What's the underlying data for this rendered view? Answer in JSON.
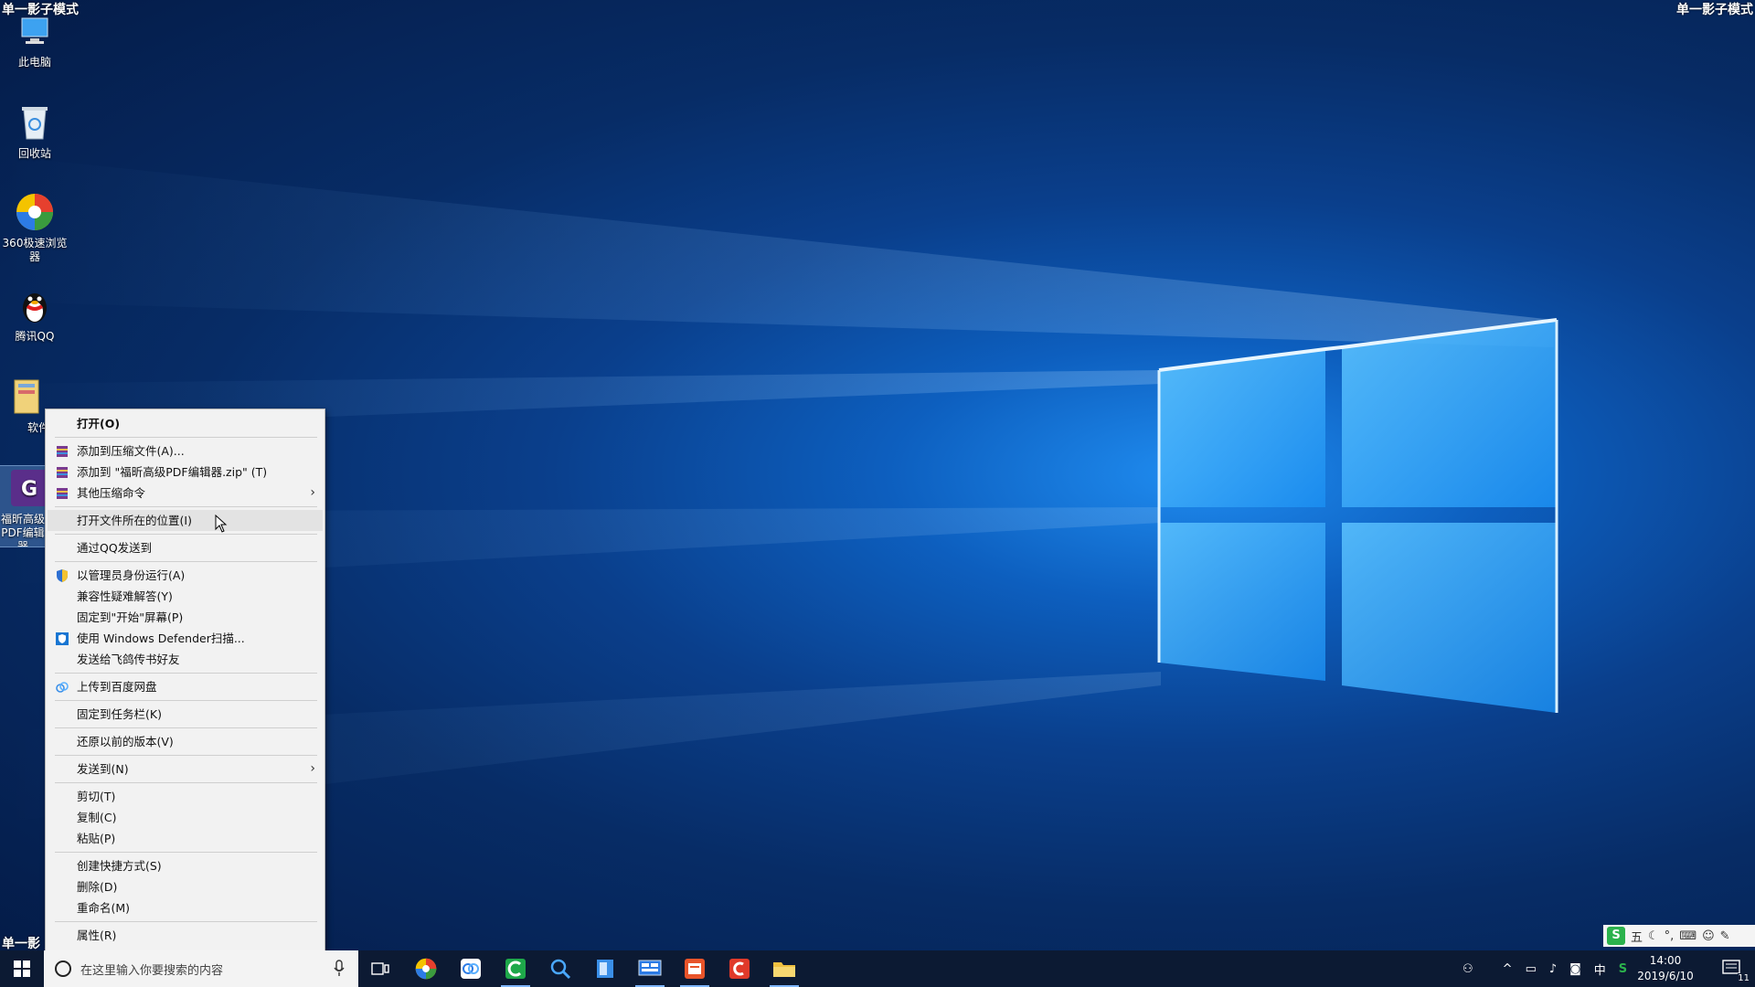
{
  "watermark": {
    "text": "单一影子模式",
    "truncated": "单一影"
  },
  "desktop_icons": [
    {
      "label": "此电脑",
      "icon": "computer-icon"
    },
    {
      "label": "回收站",
      "icon": "recycle-bin-icon"
    },
    {
      "label": "360极速浏览器",
      "icon": "browser-360-icon"
    },
    {
      "label": "腾讯QQ",
      "icon": "qq-icon"
    },
    {
      "label": "软件",
      "icon": "folder-icon"
    },
    {
      "label": "福昕高级PDF编辑器",
      "icon": "foxit-pdf-icon"
    }
  ],
  "context_menu": {
    "items": [
      {
        "label": "打开(O)",
        "bold": true
      },
      {
        "label": "添加到压缩文件(A)...",
        "icon": "winrar-icon"
      },
      {
        "label": "添加到 \"福昕高级PDF编辑器.zip\" (T)",
        "icon": "winrar-icon"
      },
      {
        "label": "其他压缩命令",
        "icon": "winrar-icon",
        "submenu": true
      },
      {
        "label": "打开文件所在的位置(I)",
        "hover": true
      },
      {
        "label": "通过QQ发送到"
      },
      {
        "label": "以管理员身份运行(A)",
        "icon": "uac-shield-icon"
      },
      {
        "label": "兼容性疑难解答(Y)"
      },
      {
        "label": "固定到\"开始\"屏幕(P)"
      },
      {
        "label": "使用 Windows Defender扫描...",
        "icon": "defender-icon"
      },
      {
        "label": "发送给飞鸽传书好友"
      },
      {
        "label": "上传到百度网盘",
        "icon": "baidu-netdisk-icon"
      },
      {
        "label": "固定到任务栏(K)"
      },
      {
        "label": "还原以前的版本(V)"
      },
      {
        "label": "发送到(N)",
        "submenu": true
      },
      {
        "label": "剪切(T)"
      },
      {
        "label": "复制(C)"
      },
      {
        "label": "粘贴(P)"
      },
      {
        "label": "创建快捷方式(S)"
      },
      {
        "label": "删除(D)"
      },
      {
        "label": "重命名(M)"
      },
      {
        "label": "属性(R)"
      }
    ],
    "submenu_arrow": "›"
  },
  "taskbar": {
    "search_placeholder": "在这里输入你要搜索的内容",
    "apps": [
      "task-view-icon",
      "browser-360-icon",
      "photos-icon",
      "camtasia-icon",
      "search-app-icon",
      "notepad-icon",
      "control-panel-icon",
      "foxit-reader-icon",
      "snagit-icon",
      "file-explorer-icon"
    ],
    "tray_ime": "中",
    "clock_time": "14:00",
    "clock_date": "2019/6/10",
    "notification_count": "11"
  },
  "ime_bar": {
    "mode": "五",
    "logo": "S"
  },
  "colors": {
    "accent": "#0078d7",
    "taskbar": "#0c1a33",
    "menu_bg": "#f2f2f2"
  }
}
